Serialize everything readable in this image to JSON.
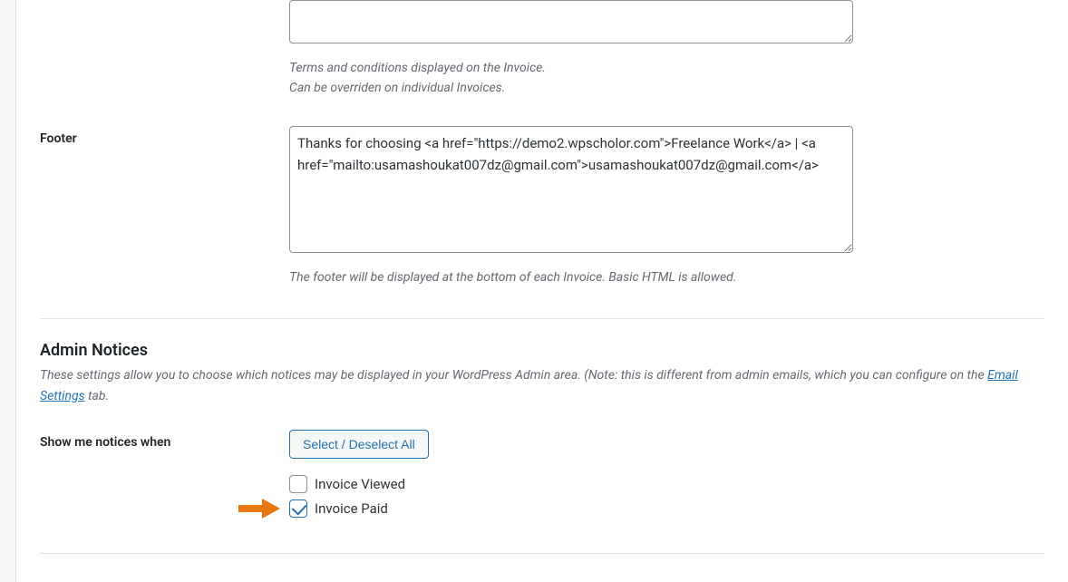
{
  "terms": {
    "value": "",
    "description_line1": "Terms and conditions displayed on the Invoice.",
    "description_line2": "Can be overriden on individual Invoices."
  },
  "footer": {
    "label": "Footer",
    "value": "Thanks for choosing <a href=\"https://demo2.wpscholor.com\">Freelance Work</a> | <a href=\"mailto:usamashoukat007dz@gmail.com\">usamashoukat007dz@gmail.com</a>",
    "description": "The footer will be displayed at the bottom of each Invoice. Basic HTML is allowed."
  },
  "admin_notices": {
    "title": "Admin Notices",
    "desc_part1": "These settings allow you to choose which notices may be displayed in your WordPress Admin area. (Note: this is different from admin emails, which you can configure on the ",
    "desc_link": "Email Settings",
    "desc_part2": " tab."
  },
  "notices": {
    "label": "Show me notices when",
    "select_all_button": "Select / Deselect All",
    "options": [
      {
        "label": "Invoice Viewed",
        "checked": false,
        "highlight": false
      },
      {
        "label": "Invoice Paid",
        "checked": true,
        "highlight": true
      }
    ]
  }
}
